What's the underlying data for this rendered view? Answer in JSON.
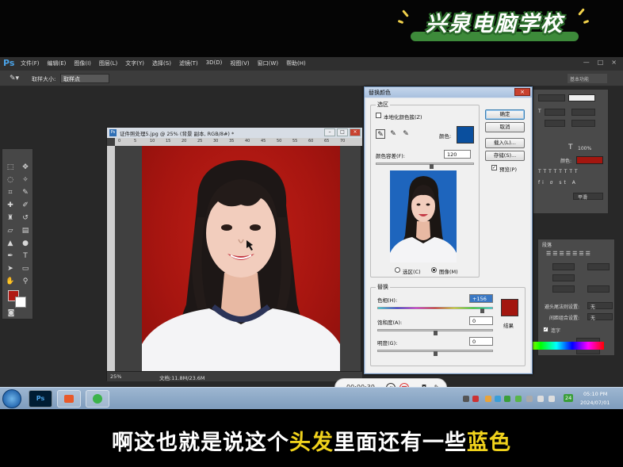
{
  "branding": {
    "title": "兴泉电脑学校"
  },
  "app": {
    "logo": "Ps",
    "menu": [
      "文件(F)",
      "编辑(E)",
      "图像(I)",
      "图层(L)",
      "文字(Y)",
      "选择(S)",
      "滤镜(T)",
      "3D(D)",
      "视图(V)",
      "窗口(W)",
      "帮助(H)"
    ],
    "window_controls": [
      "—",
      "□",
      "×"
    ],
    "options_bar": {
      "tool_icon": "eyedropper-icon",
      "sample_label": "取样大小:",
      "sample_value": "取样点",
      "right_field": "基本功能"
    }
  },
  "document": {
    "title": "证件照处理5.jpg @ 25% (背景 副本, RGB/8#) *",
    "ruler_ticks": [
      "0",
      "5",
      "10",
      "15",
      "20",
      "25",
      "30",
      "35",
      "40",
      "45",
      "50",
      "55",
      "60",
      "65",
      "70"
    ],
    "zoom": "25%",
    "doc_size": "文档:11.8M/23.6M",
    "foreground_color": "#b01a14",
    "background_color": "#ffffff"
  },
  "dialog": {
    "title": "替换颜色",
    "close": "×",
    "selection": {
      "group_label": "选区",
      "localized_label": "本地化颜色簇(Z)",
      "color_label": "颜色:",
      "swatch_color": "#0a4f9e",
      "fuzziness_label": "颜色容差(F):",
      "fuzziness_value": "120",
      "radio_selection": "选区(C)",
      "radio_image": "图像(M)"
    },
    "buttons": {
      "ok": "确定",
      "cancel": "取消",
      "load": "载入(L)...",
      "save": "存储(S)...",
      "preview": "预览(P)"
    },
    "replacement": {
      "group_label": "替换",
      "hue_label": "色相(H):",
      "hue_value": "+156",
      "saturation_label": "饱和度(A):",
      "saturation_value": "0",
      "lightness_label": "明度(G):",
      "lightness_value": "0",
      "result_label": "结果",
      "result_color": "#a3160f"
    }
  },
  "panels": {
    "paragraph_title": "段落",
    "hyphenate_label": "连字",
    "row1_label": "避头尾法则设置:",
    "row1_value": "无",
    "row2_label": "间距组合设置:",
    "row2_value": "无",
    "char_color_label": "颜色:",
    "char_color": "#a3160f",
    "tracking_value": "100%",
    "strength_value": "平滑"
  },
  "recorder": {
    "time": "00:00:39"
  },
  "taskbar": {
    "time": "05:10 PM",
    "date": "2024/07/01",
    "badge": "24"
  },
  "subtitle": {
    "part1": "啊这也就是说这个",
    "part2": "头发",
    "part3": "里面还有一些",
    "part4": "蓝色"
  }
}
